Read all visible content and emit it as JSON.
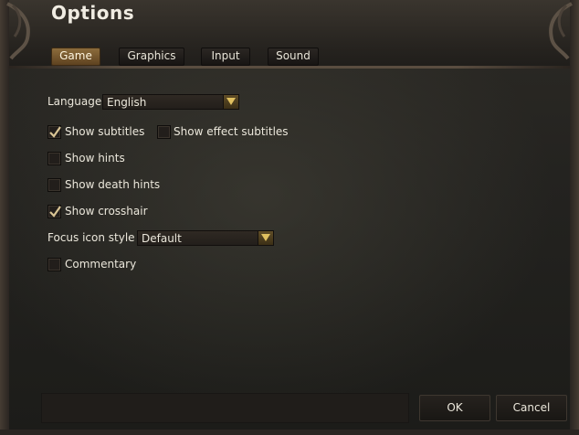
{
  "window": {
    "title": "Options"
  },
  "tabs": [
    {
      "label": "Game",
      "active": true
    },
    {
      "label": "Graphics",
      "active": false
    },
    {
      "label": "Input",
      "active": false
    },
    {
      "label": "Sound",
      "active": false
    }
  ],
  "game": {
    "language": {
      "label": "Language",
      "value": "English"
    },
    "options": {
      "show_subtitles": {
        "label": "Show subtitles",
        "checked": true
      },
      "show_effect_subtitles": {
        "label": "Show effect subtitles",
        "checked": false
      },
      "show_hints": {
        "label": "Show hints",
        "checked": false
      },
      "show_death_hints": {
        "label": "Show death hints",
        "checked": false
      },
      "show_crosshair": {
        "label": "Show crosshair",
        "checked": true
      },
      "commentary": {
        "label": "Commentary",
        "checked": false
      }
    },
    "focus_icon_style": {
      "label": "Focus icon style",
      "value": "Default"
    }
  },
  "buttons": {
    "ok": "OK",
    "cancel": "Cancel"
  },
  "colors": {
    "accent": "#8c6c3c",
    "dropdown_arrow": "#e0c060",
    "check": "#d8c494"
  }
}
